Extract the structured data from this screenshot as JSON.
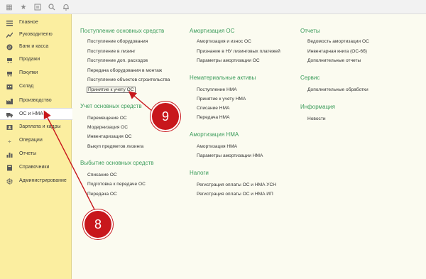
{
  "sidebar": {
    "items": [
      {
        "label": "Главное",
        "icon": "menu-lines-icon"
      },
      {
        "label": "Руководителю",
        "icon": "chart-icon"
      },
      {
        "label": "Банк и касса",
        "icon": "coin-icon"
      },
      {
        "label": "Продажи",
        "icon": "cart-out-icon"
      },
      {
        "label": "Покупки",
        "icon": "cart-in-icon"
      },
      {
        "label": "Склад",
        "icon": "warehouse-icon"
      },
      {
        "label": "Производство",
        "icon": "factory-icon"
      },
      {
        "label": "ОС и НМА",
        "icon": "truck-icon"
      },
      {
        "label": "Зарплата и кадры",
        "icon": "people-icon"
      },
      {
        "label": "Операции",
        "icon": "operations-icon"
      },
      {
        "label": "Отчеты",
        "icon": "report-chart-icon"
      },
      {
        "label": "Справочники",
        "icon": "book-icon"
      },
      {
        "label": "Администрирование",
        "icon": "gear-icon"
      }
    ]
  },
  "sections": {
    "col1": {
      "s1": {
        "title": "Поступление основных средств",
        "links": [
          "Поступление оборудования",
          "Поступление в лизинг",
          "Поступление доп. расходов",
          "Передача оборудования в монтаж",
          "Поступление объектов строительства",
          "Принятие к учету ОС"
        ]
      },
      "s2": {
        "title": "Учет основных средств",
        "links": [
          "Перемещение ОС",
          "Модернизация ОС",
          "Инвентаризация ОС",
          "Выкуп предметов лизинга"
        ]
      },
      "s3": {
        "title": "Выбытие основных средств",
        "links": [
          "Списание ОС",
          "Подготовка к передаче ОС",
          "Передача ОС"
        ]
      }
    },
    "col2": {
      "s1": {
        "title": "Амортизация ОС",
        "links": [
          "Амортизация и износ ОС",
          "Признание в НУ лизинговых платежей",
          "Параметры амортизации ОС"
        ]
      },
      "s2": {
        "title": "Нематериальные активы",
        "links": [
          "Поступление НМА",
          "Принятие к учету НМА",
          "Списание НМА",
          "Передача НМА"
        ]
      },
      "s3": {
        "title": "Амортизация НМА",
        "links": [
          "Амортизация НМА",
          "Параметры амортизации НМА"
        ]
      },
      "s4": {
        "title": "Налоги",
        "links": [
          "Регистрация оплаты ОС и НМА УСН",
          "Регистрация оплаты ОС и НМА ИП"
        ]
      }
    },
    "col3": {
      "s1": {
        "title": "Отчеты",
        "links": [
          "Ведомость амортизации ОС",
          "Инвентарная книга (ОС-6б)",
          "Дополнительные отчеты"
        ]
      },
      "s2": {
        "title": "Сервис",
        "links": [
          "Дополнительные обработки"
        ]
      },
      "s3": {
        "title": "Информация",
        "links": [
          "Новости"
        ]
      }
    }
  },
  "callouts": {
    "c8": "8",
    "c9": "9"
  },
  "colors": {
    "sidebar": "#fbeea0",
    "section_title": "#3a9b5a",
    "callout": "#c8171c",
    "background": "#fbfbf0"
  }
}
